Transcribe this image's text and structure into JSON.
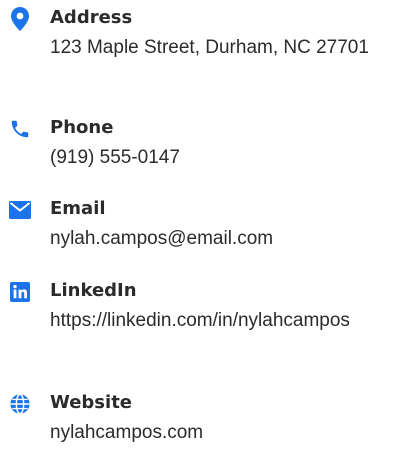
{
  "accent_color": "#1a73e8",
  "contact": {
    "address": {
      "icon": "map-pin-icon",
      "label": "Address",
      "value": "123 Maple Street, Durham, NC 27701"
    },
    "phone": {
      "icon": "phone-icon",
      "label": "Phone",
      "value": "(919) 555-0147"
    },
    "email": {
      "icon": "envelope-icon",
      "label": "Email",
      "value": "nylah.campos@email.com"
    },
    "linkedin": {
      "icon": "linkedin-icon",
      "label": "LinkedIn",
      "value": "https://linkedin.com/in/nylahcampos"
    },
    "website": {
      "icon": "globe-icon",
      "label": "Website",
      "value": "nylahcampos.com"
    }
  }
}
